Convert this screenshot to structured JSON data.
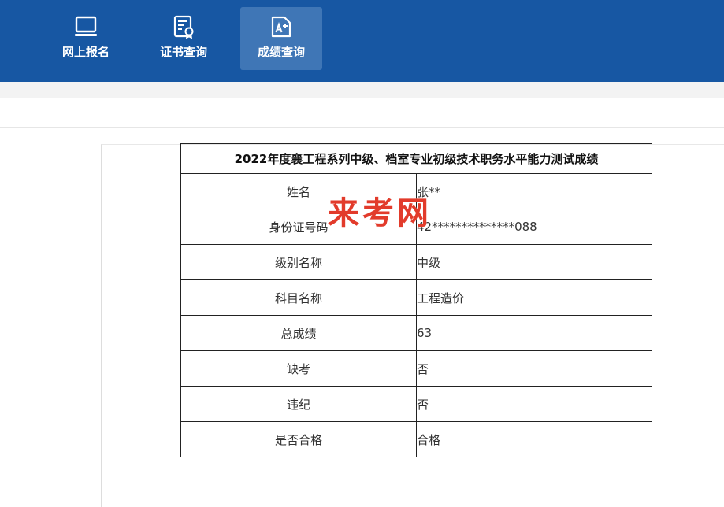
{
  "nav": {
    "items": [
      {
        "label": "网上报名",
        "icon": "monitor-icon"
      },
      {
        "label": "证书查询",
        "icon": "certificate-icon"
      },
      {
        "label": "成绩查询",
        "icon": "score-icon"
      }
    ],
    "active_index": 2
  },
  "result": {
    "title": "2022年度襄工程系列中级、档室专业初级技术职务水平能力测试成绩",
    "rows": [
      {
        "label": "姓名",
        "value": "张**"
      },
      {
        "label": "身份证号码",
        "value": "42**************088"
      },
      {
        "label": "级别名称",
        "value": "中级"
      },
      {
        "label": "科目名称",
        "value": "工程造价"
      },
      {
        "label": "总成绩",
        "value": "63"
      },
      {
        "label": "缺考",
        "value": "否"
      },
      {
        "label": "违纪",
        "value": "否"
      },
      {
        "label": "是否合格",
        "value": "合格"
      }
    ]
  },
  "watermark": "来考网",
  "colors": {
    "header_bg": "#1757a3",
    "active_tab_bg": "#3f76b6",
    "watermark": "#e23b2b"
  }
}
